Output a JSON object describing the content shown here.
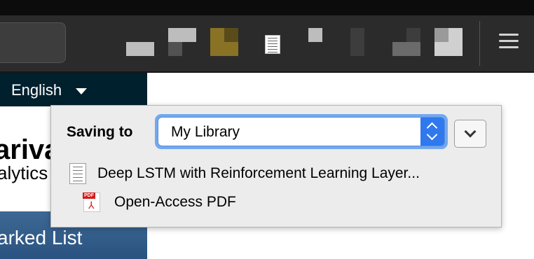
{
  "browser": {
    "menu_icon": "hamburger-menu-icon",
    "extension_icons": [
      "extension-icon",
      "extension-icon",
      "extension-icon",
      "document-icon",
      "extension-icon",
      "extension-icon",
      "extension-icon",
      "extension-icon"
    ]
  },
  "page": {
    "language": "English",
    "brand_line1": "ariva",
    "brand_line2": "alytics",
    "marked_list_label": "arked List"
  },
  "save_popup": {
    "saving_to_label": "Saving to",
    "library_selected": "My Library",
    "item_title": "Deep LSTM with Reinforcement Learning Layer...",
    "attachment_title": "Open-Access PDF",
    "attachment_badge": "PDF",
    "colors": {
      "select_accent": "#2f78ee",
      "focus_ring": "#74a8ee",
      "pdf_red": "#d11b1b"
    }
  }
}
